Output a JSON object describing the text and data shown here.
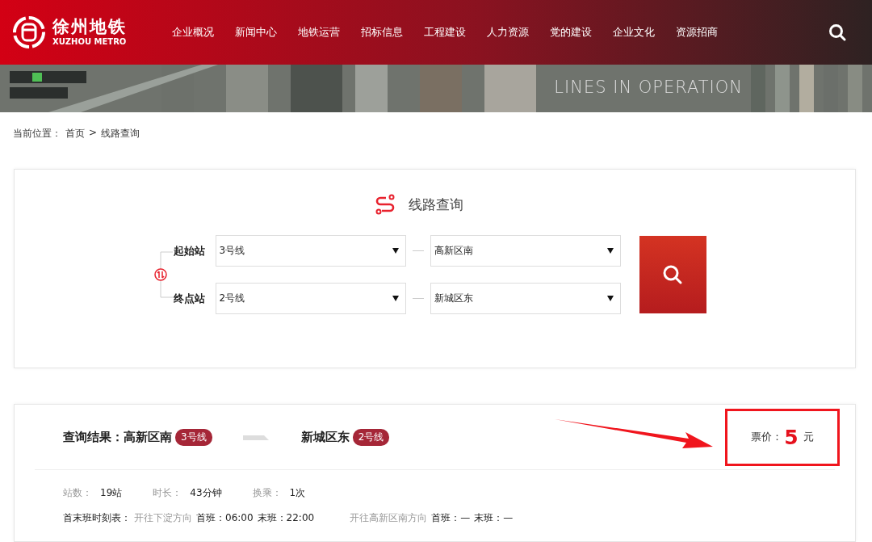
{
  "header": {
    "logo": {
      "name": "徐州地铁",
      "subtitle": "XUZHOU METRO"
    },
    "nav": [
      "企业概况",
      "新闻中心",
      "地铁运营",
      "招标信息",
      "工程建设",
      "人力资源",
      "党的建设",
      "企业文化",
      "资源招商"
    ]
  },
  "banner": {
    "title": "LINES IN OPERATION"
  },
  "breadcrumb": {
    "label": "当前位置：",
    "items": [
      "首页",
      "线路查询"
    ],
    "separator": ">"
  },
  "query": {
    "title": "线路查询",
    "rows": [
      {
        "label": "起始站",
        "line": "3号线",
        "station": "高新区南"
      },
      {
        "label": "终点站",
        "line": "2号线",
        "station": "新城区东"
      }
    ]
  },
  "result": {
    "label": "查询结果：",
    "from": {
      "station": "高新区南",
      "line": "3号线"
    },
    "to": {
      "station": "新城区东",
      "line": "2号线"
    },
    "fare": {
      "label": "票价：",
      "amount": "5",
      "unit": "元",
      "highlighted": true
    },
    "stats": [
      {
        "label": "站数：",
        "value": "19站"
      },
      {
        "label": "时长：",
        "value": "43分钟"
      },
      {
        "label": "换乘：",
        "value": "1次"
      }
    ],
    "timetable": {
      "label": "首末班时刻表：",
      "directions": [
        {
          "direction": "开往下淀方向",
          "first_label": "首班：",
          "first": "06:00",
          "last_label": "末班：",
          "last": "22:00"
        },
        {
          "direction": "开往高新区南方向",
          "first_label": "首班：",
          "first": "—",
          "last_label": "末班：",
          "last": "—"
        }
      ]
    }
  }
}
